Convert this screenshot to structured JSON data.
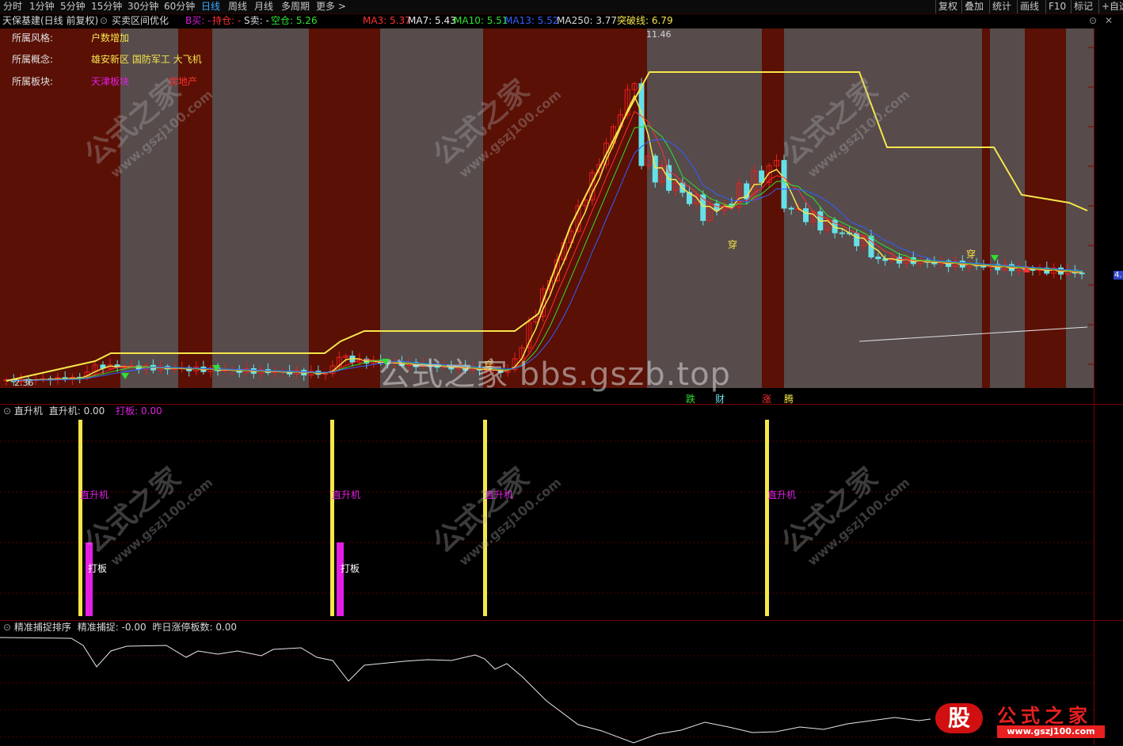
{
  "toolbar": {
    "tabs": [
      "分时",
      "1分钟",
      "5分钟",
      "15分钟",
      "30分钟",
      "60分钟",
      "日线",
      "周线",
      "月线",
      "多周期",
      "更多 >"
    ],
    "active_tab": "日线",
    "right_buttons": [
      "复权",
      "叠加",
      "统计",
      "画线",
      "F10",
      "标记",
      "+自选"
    ]
  },
  "infobar": {
    "stock": "天保基建(日线 前复权)",
    "formula": "买卖区间优化",
    "b_buy": "B买: -",
    "hold": "持仓: -",
    "s_sell": "S卖: -",
    "empty": "空仓: 5.26",
    "ma3": "MA3: 5.37",
    "ma7": "MA7: 5.43",
    "ma10": "MA10: 5.51",
    "ma13": "MA13: 5.52",
    "ma250": "MA250: 3.77",
    "breakout": "突破线: 6.79"
  },
  "info_panel": {
    "style_label": "所属风格:",
    "style_value": "户数增加",
    "concept_label": "所属概念:",
    "concept_value": "雄安新区 国防军工 大飞机",
    "sector_label": "所属板块:",
    "sector_value1": "天津板块",
    "sector_value2": "房地产"
  },
  "price_labels": {
    "high": "11.46",
    "low": "2.36",
    "right_edge": "4."
  },
  "markers": {
    "chuan": "穿",
    "bottom_tags": [
      "跌",
      "财",
      "涨",
      "腾"
    ]
  },
  "panel2": {
    "title": "直升机",
    "value": "直升机: 0.00",
    "dabang": "打板: 0.00",
    "bar_label": "直升机",
    "dab_label": "打板"
  },
  "panel3": {
    "title": "精准捕捉排序",
    "value": "精准捕捉: -0.00",
    "zt": "昨日涨停板数: 0.00"
  },
  "watermark": {
    "main": "公式之家 bbs.gszb.top",
    "diag_cn": "公式之家",
    "diag_url": "www.gszj100.com"
  },
  "logo": {
    "glyph": "股",
    "text": "公式之家",
    "url": "www.gszj100.com"
  },
  "colors": {
    "red_band": "#5a1005",
    "gray_band": "#574b4b",
    "up": "#e8201e",
    "down": "#66e0e8",
    "yellow": "#f5e64b",
    "magenta": "#e21fe3"
  }
}
